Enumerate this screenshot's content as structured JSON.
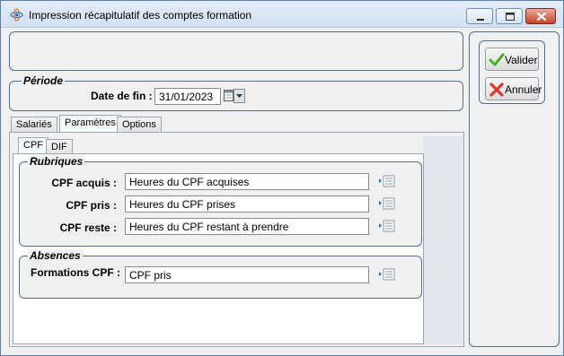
{
  "window": {
    "title": "Impression récapitulatif des comptes formation"
  },
  "periode": {
    "group_title": "Période",
    "date_label": "Date de fin :",
    "date_value": "31/01/2023"
  },
  "tabs": {
    "main": [
      "Salariés",
      "Paramètres",
      "Options"
    ],
    "main_active": "Paramètres",
    "sub": [
      "CPF",
      "DIF"
    ],
    "sub_active": "CPF"
  },
  "rubriques": {
    "group_title": "Rubriques",
    "rows": [
      {
        "label": "CPF acquis :",
        "value": "Heures du CPF acquises"
      },
      {
        "label": "CPF pris :",
        "value": "Heures du CPF prises"
      },
      {
        "label": "CPF reste :",
        "value": "Heures du CPF restant à prendre"
      }
    ]
  },
  "absences": {
    "group_title": "Absences",
    "rows": [
      {
        "label": "Formations CPF :",
        "value": "CPF pris"
      }
    ]
  },
  "actions": {
    "validate_label": "Valider",
    "cancel_label": "Annuler"
  },
  "icons": {
    "app": "app-icon",
    "calendar": "calendar-icon",
    "dropdown": "chevron-down-icon",
    "select_list": "list-select-icon",
    "validate": "checkmark-icon",
    "cancel": "red-x-icon"
  },
  "colors": {
    "accent_border": "#4f6f90",
    "close_button": "#c7432d",
    "validate_icon": "#4caf1f",
    "cancel_icon": "#d93a2a"
  }
}
